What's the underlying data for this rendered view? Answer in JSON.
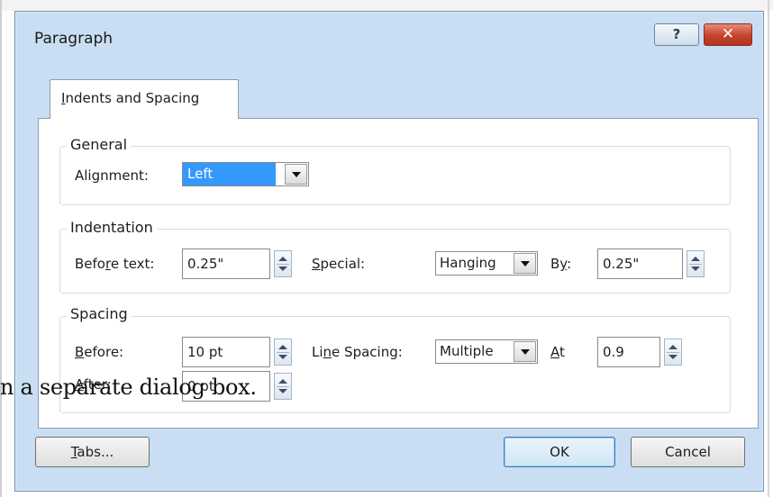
{
  "background": {
    "caption": "n a separate dialog box."
  },
  "dialog": {
    "title": "Paragraph",
    "help_glyph": "?",
    "close_glyph": "✕",
    "tab_label": "Indents and Spacing",
    "general": {
      "title": "General",
      "alignment_label": "Alignment:",
      "alignment_value": "Left"
    },
    "indentation": {
      "title": "Indentation",
      "before_text_label": "Before text:",
      "before_text_value": "0.25\"",
      "special_label": "Special:",
      "special_value": "Hanging",
      "by_label": "By:",
      "by_value": "0.25\""
    },
    "spacing": {
      "title": "Spacing",
      "before_label": "Before:",
      "before_value": "10 pt",
      "after_label": "After:",
      "after_value": "0 pt",
      "line_spacing_label": "Line Spacing:",
      "line_spacing_value": "Multiple",
      "at_label": "At",
      "at_value": "0.9"
    },
    "buttons": {
      "tabs": "Tabs...",
      "ok": "OK",
      "cancel": "Cancel"
    }
  },
  "colors": {
    "dialog_frame": "#c9def2",
    "selection": "#3399ff",
    "close_button": "#c2442c"
  }
}
